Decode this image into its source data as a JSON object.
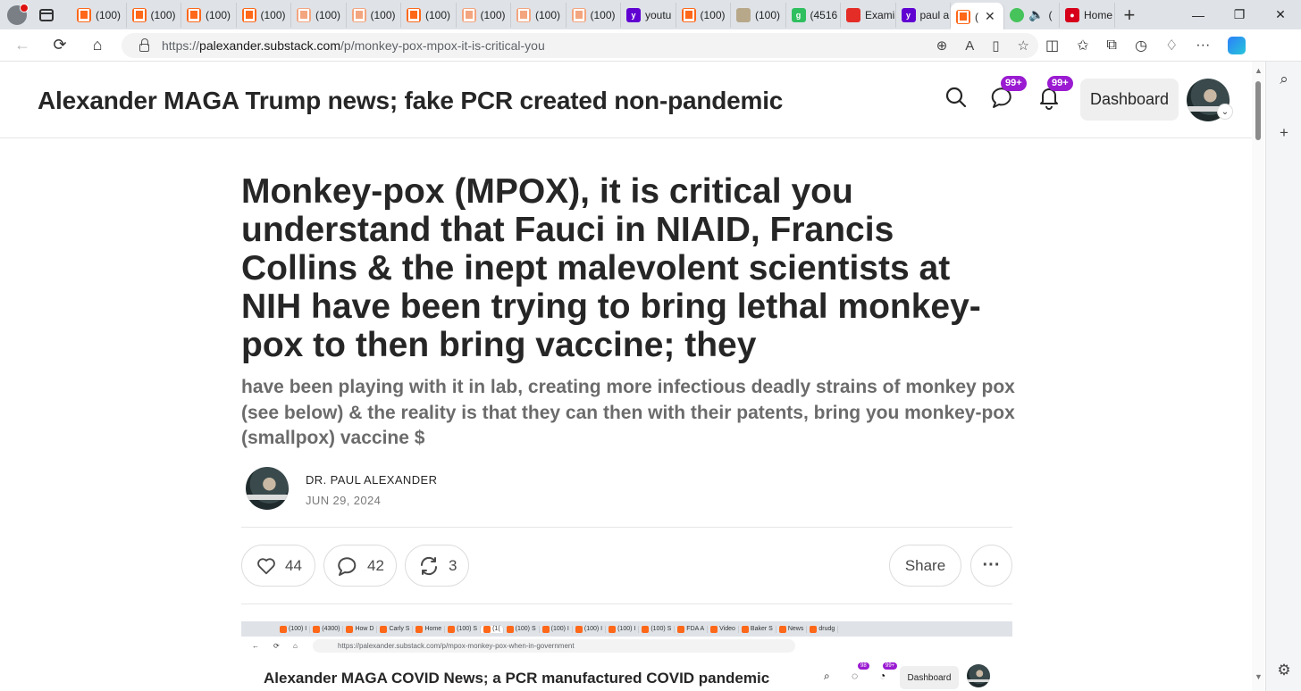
{
  "browser": {
    "tabs": [
      {
        "label": "(100)",
        "favicon": "substack"
      },
      {
        "label": "(100)",
        "favicon": "substack"
      },
      {
        "label": "(100)",
        "favicon": "substack"
      },
      {
        "label": "(100)",
        "favicon": "substack"
      },
      {
        "label": "(100)",
        "favicon": "substack-faded"
      },
      {
        "label": "(100)",
        "favicon": "substack-faded"
      },
      {
        "label": "(100)",
        "favicon": "substack"
      },
      {
        "label": "(100)",
        "favicon": "substack-faded"
      },
      {
        "label": "(100)",
        "favicon": "substack-faded"
      },
      {
        "label": "(100)",
        "favicon": "substack-faded"
      },
      {
        "label": "youtu",
        "favicon": "yahoo"
      },
      {
        "label": "(100)",
        "favicon": "substack"
      },
      {
        "label": "(100)",
        "favicon": "image"
      },
      {
        "label": "(4516",
        "favicon": "g"
      },
      {
        "label": "Exami",
        "favicon": "youtube"
      },
      {
        "label": "paul a",
        "favicon": "yahoo"
      },
      {
        "label": "(",
        "favicon": "substack",
        "active": true
      },
      {
        "label": "(",
        "favicon": "play"
      },
      {
        "label": "Home",
        "favicon": "red"
      }
    ],
    "url_prefix": "https://",
    "url_host": "palexander.substack.com",
    "url_path": "/p/monkey-pox-mpox-it-is-critical-you"
  },
  "site": {
    "title": "Alexander MAGA Trump news; fake PCR created non-pandemic",
    "chat_badge": "99+",
    "notif_badge": "99+",
    "dashboard_label": "Dashboard"
  },
  "post": {
    "title": "Monkey-pox (MPOX), it is critical you understand that Fauci in NIAID, Francis Collins & the inept malevolent scientists at NIH have been trying to bring lethal monkey-pox to then bring vaccine; they",
    "subtitle": "have been playing with it in lab, creating more infectious deadly strains of monkey pox (see below) & the reality is that they can then with their patents, bring you monkey-pox (smallpox) vaccine $",
    "author": "DR. PAUL ALEXANDER",
    "date": "JUN 29, 2024",
    "likes": "44",
    "comments": "42",
    "restacks": "3",
    "share_label": "Share"
  },
  "embed": {
    "tabs": [
      "(100) I",
      "(4300)",
      "How D",
      "Carly S",
      "Home",
      "(100) S",
      "(1(",
      "(100) S",
      "(100) I",
      "(100) I",
      "(100) I",
      "(100) S",
      "FDA A",
      "Video",
      "Baker S",
      "News",
      "drudg"
    ],
    "url": "https://palexander.substack.com/p/mpox-monkey-pox-when-in-government",
    "site_title": "Alexander MAGA COVID News; a PCR manufactured COVID pandemic",
    "chat_badge": "98",
    "notif_badge": "99+",
    "dashboard_label": "Dashboard"
  },
  "colors": {
    "accent_badge": "#9a1bd1",
    "substack_orange": "#ff6719",
    "text_dark": "#262626",
    "text_muted": "#6b6b6b"
  }
}
